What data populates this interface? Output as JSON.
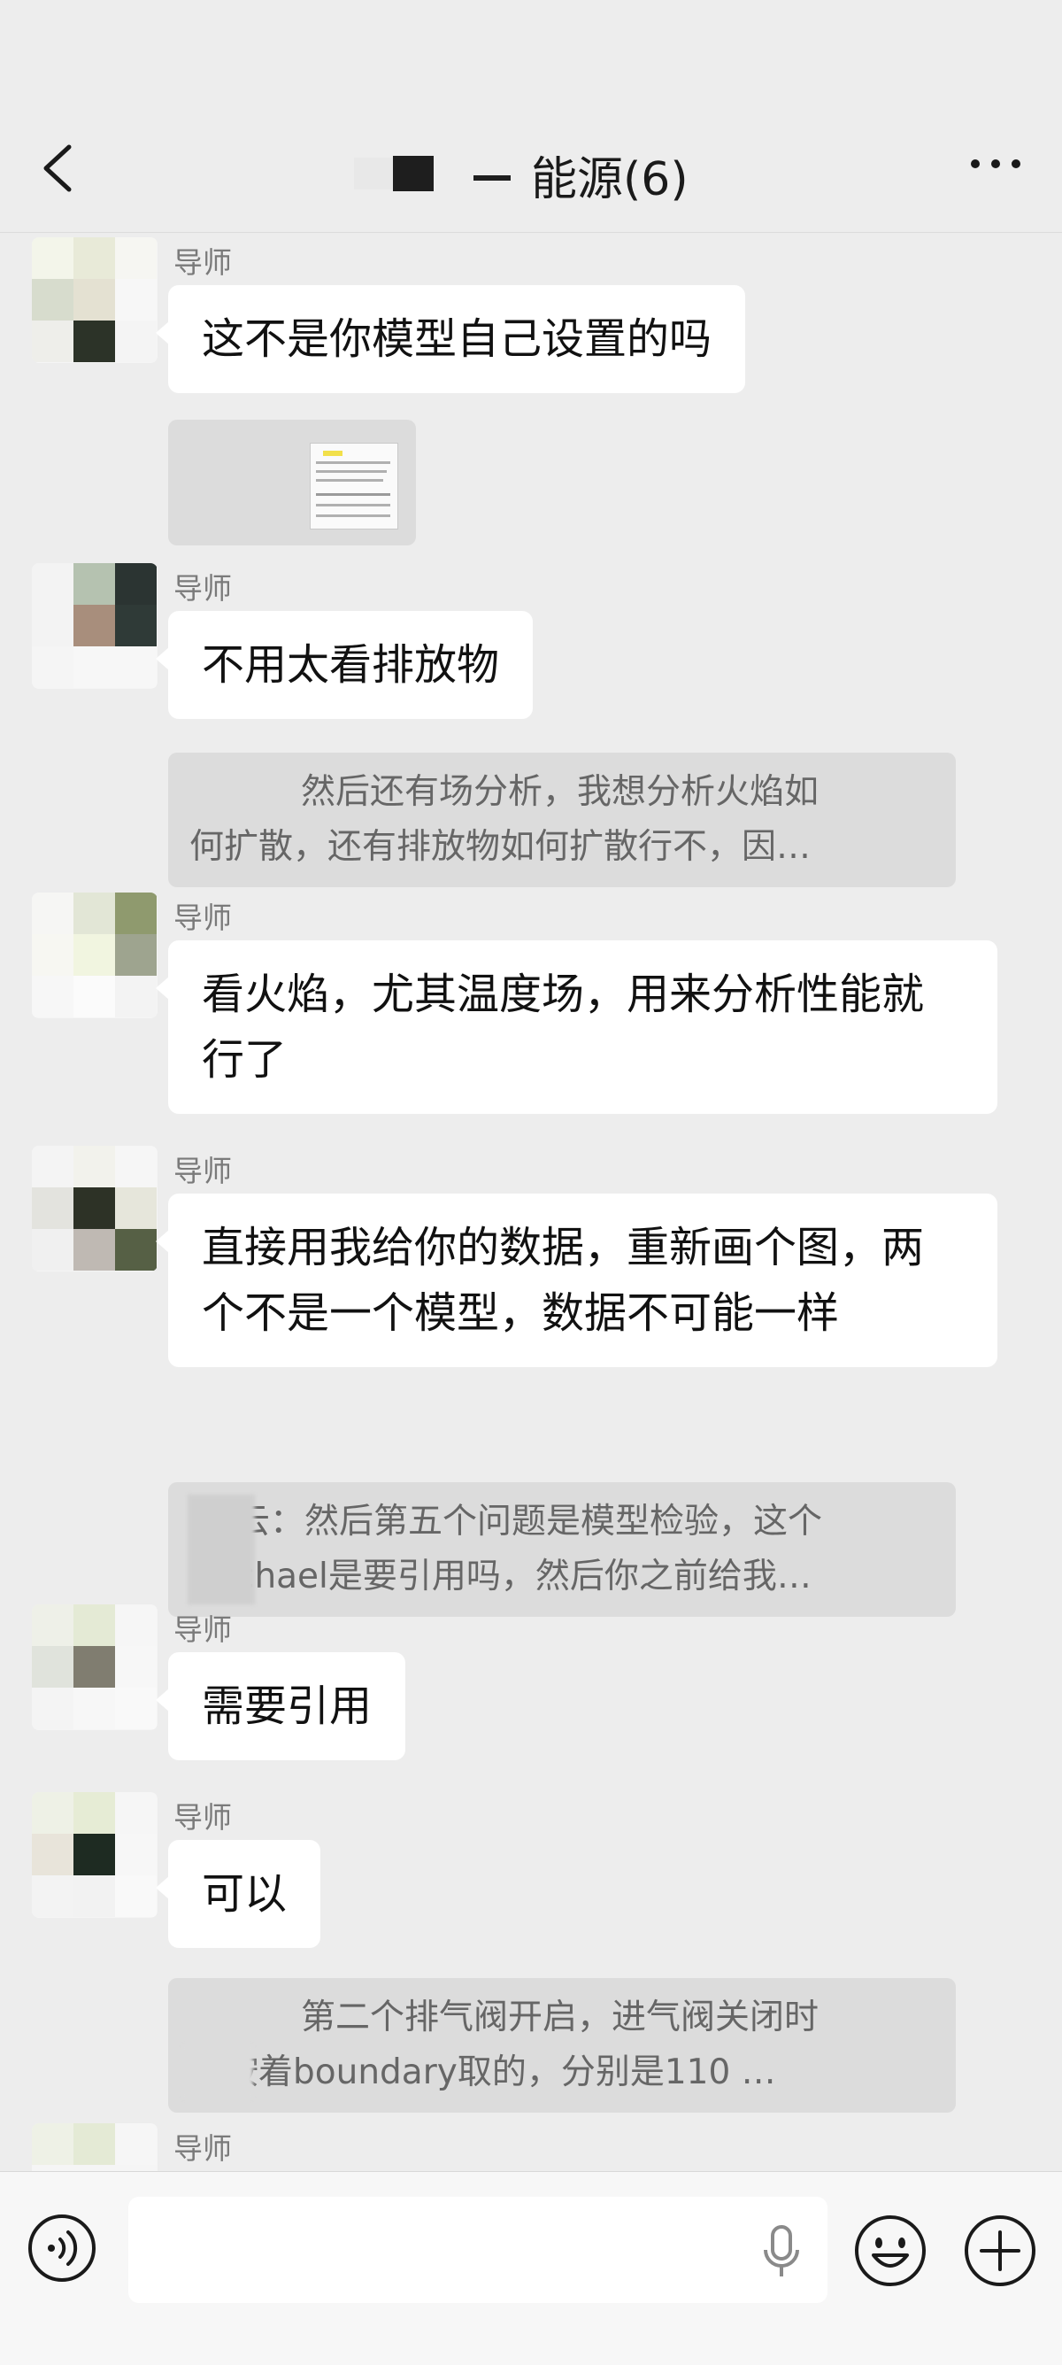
{
  "header": {
    "title": "能源(6)"
  },
  "messages": [
    {
      "sender": "导师",
      "text": "这不是你模型自己设置的吗",
      "quote_type": "image"
    },
    {
      "sender": "导师",
      "text": "不用太看排放物",
      "quote_lines": [
        "然后还有场分析，我想分析火焰如",
        "何扩散，还有排放物如何扩散行不，因…"
      ]
    },
    {
      "sender": "导师",
      "text": "看火焰，尤其温度场，用来分析性能就行了"
    },
    {
      "sender": "导师",
      "text": "直接用我给你的数据，重新画个图，两个不是一个模型，数据不可能一样",
      "quote_lines": [
        "云：然后第五个问题是模型检验，这个",
        "chael是要引用吗，然后你之前给我…"
      ]
    },
    {
      "sender": "导师",
      "text": "需要引用"
    },
    {
      "sender": "导师",
      "text": "可以",
      "quote_lines": [
        "第二个排气阀开启，进气阀关闭时",
        "我按着boundary取的，分别是110 …"
      ]
    },
    {
      "sender": "导师"
    }
  ],
  "input": {
    "placeholder": ""
  },
  "colors": {
    "background": "#ededed",
    "bubble": "#ffffff",
    "quote": "#dcdcdc",
    "input_bar": "#f7f7f7"
  },
  "icons": [
    "back-arrow-icon",
    "more-dots-icon",
    "voice-icon",
    "microphone-icon",
    "emoji-icon",
    "plus-icon"
  ]
}
